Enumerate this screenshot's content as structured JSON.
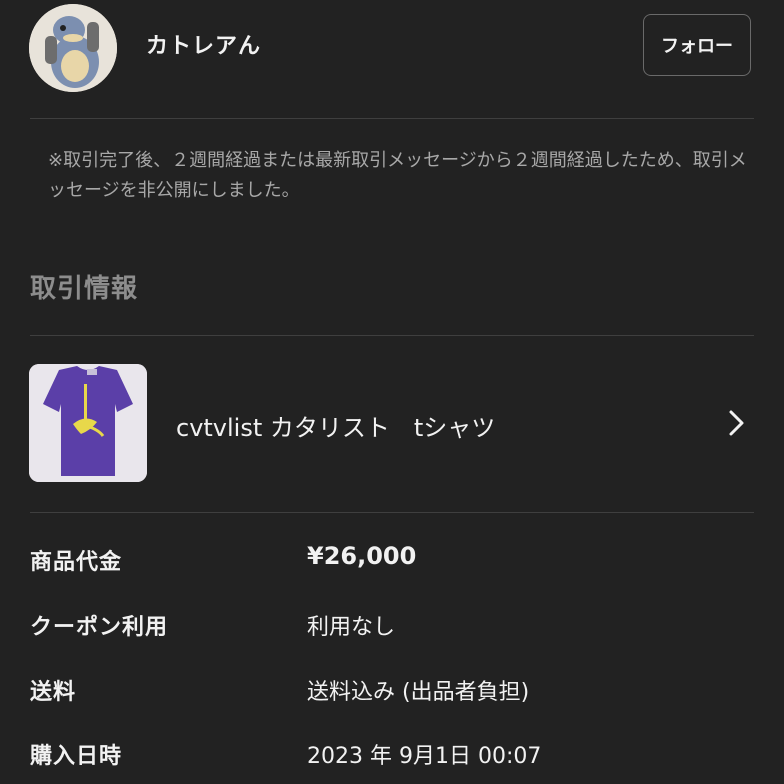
{
  "seller": {
    "username": "カトレアん",
    "follow_label": "フォロー"
  },
  "notice": {
    "text": "※取引完了後、２週間経過または最新取引メッセージから２週間経過したため、取引メッセージを非公開にしました。"
  },
  "section": {
    "title": "取引情報"
  },
  "product": {
    "name": "cvtvlist カタリスト　tシャツ",
    "shirt_color": "#5b3fa8"
  },
  "details": [
    {
      "label": "商品代金",
      "value": "¥26,000"
    },
    {
      "label": "クーポン利用",
      "value": "利用なし"
    },
    {
      "label": "送料",
      "value": "送料込み (出品者負担)"
    },
    {
      "label": "購入日時",
      "value": "2023 年 9月1日 00:07"
    }
  ],
  "colors": {
    "background": "#222222",
    "divider": "#3f3f3f",
    "muted_text": "#a8a8a8"
  }
}
